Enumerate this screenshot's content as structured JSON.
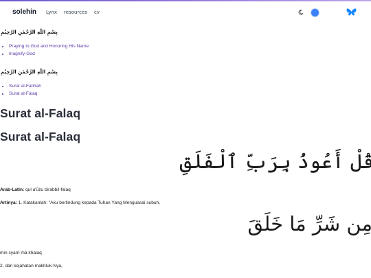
{
  "nav": {
    "brand": "solehin",
    "links": [
      "Lynx",
      "resources",
      "cv"
    ],
    "icons": [
      "moon-icon",
      "theme-toggle",
      "butterfly-icon"
    ],
    "colors": {
      "toggle": "#3b82f6",
      "butterfly": "#1185fe",
      "accent_bar": "#7b68d8"
    }
  },
  "bismillah": "بِسْمِ اللّٰهِ الرَّحْمٰنِ الرَّحِيْمِ",
  "group1": {
    "items": [
      "Praying to God and Honoring His Name",
      "magnify-God"
    ]
  },
  "group2": {
    "items": [
      "Surat al-Fatihah",
      "Surat al-Falaq"
    ]
  },
  "headings": [
    "Surat al-Falaq",
    "Surat al-Falaq"
  ],
  "verses": [
    {
      "arabic": "قُلْ أَعُوذُ بِرَبِّ ٱلْفَلَقِ",
      "latin_label": "Arab-Latin:",
      "latin": " qul a'ūżu birabbil-falaq",
      "translation_label": "Artinya:",
      "translation": " 1. Katakanlah: \"Aku berlindung kepada Tuhan Yang Menguasai subuh,"
    },
    {
      "arabic": "مِن شَرِّ مَا خَلَقَ",
      "latin": "min syarri mā khalaq",
      "translation": "2. dari kejahatan makhluk-Nya,"
    }
  ]
}
